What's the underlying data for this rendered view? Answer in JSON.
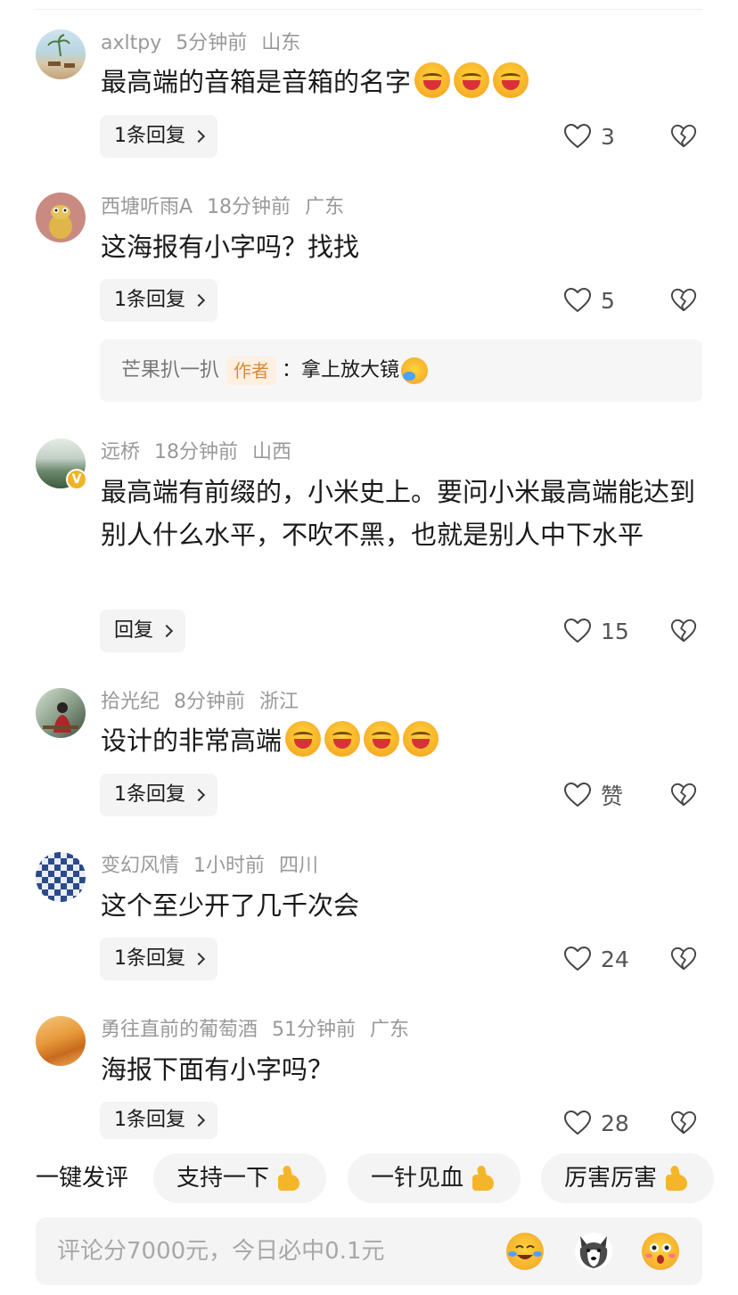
{
  "comments": [
    {
      "user": "axltpy",
      "time": "5分钟前",
      "location": "山东",
      "text": "最高端的音箱是音箱的名字",
      "emoji_count": 3,
      "reply_label": "1条回复",
      "likes": "3"
    },
    {
      "user": "西塘听雨A",
      "time": "18分钟前",
      "location": "广东",
      "text": "这海报有小字吗？找找",
      "reply_label": "1条回复",
      "likes": "5",
      "sub_reply": {
        "author": "芒果扒一扒",
        "tag": "作者",
        "text": "：拿上放大镜"
      }
    },
    {
      "user": "远桥",
      "time": "18分钟前",
      "location": "山西",
      "text": "最高端有前缀的，小米史上。要问小米最高端能达到别人什么水平，不吹不黑，也就是别人中下水平",
      "reply_label": "回复",
      "likes": "15",
      "verified_badge": "V"
    },
    {
      "user": "拾光纪",
      "time": "8分钟前",
      "location": "浙江",
      "text": "设计的非常高端",
      "emoji_count": 4,
      "reply_label": "1条回复",
      "likes": "赞"
    },
    {
      "user": "变幻风情",
      "time": "1小时前",
      "location": "四川",
      "text": "这个至少开了几千次会",
      "reply_label": "1条回复",
      "likes": "24"
    },
    {
      "user": "勇往直前的葡萄酒",
      "time": "51分钟前",
      "location": "广东",
      "text": "海报下面有小字吗？",
      "reply_label": "1条回复",
      "likes": "28"
    }
  ],
  "quick_comment": {
    "label": "一键发评",
    "chips": [
      "支持一下",
      "一针见血",
      "厉害厉害"
    ]
  },
  "input": {
    "placeholder": "评论分7000元，今日必中0.1元",
    "emoji_icons": [
      "crying-laughing-face-icon",
      "husky-dog-face-icon",
      "flushed-face-icon"
    ]
  },
  "colors": {
    "meta_text": "#999999",
    "author_tag_bg": "#fdf0e0",
    "author_tag_text": "#d88a3b",
    "bar_bg": "#f4f4f5",
    "verified_badge": "#f0b429"
  }
}
